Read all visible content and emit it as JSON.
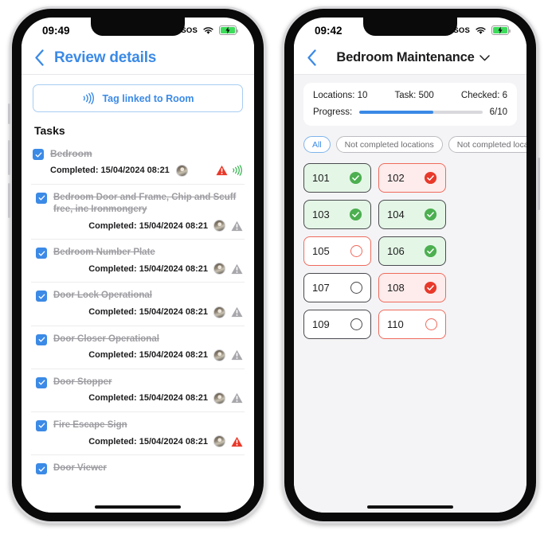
{
  "colors": {
    "accent_blue": "#3b8ae6",
    "green": "#4caf50",
    "green_bg": "#e4f6e6",
    "red": "#e8392a",
    "red_soft": "#ef6a5c",
    "red_bg": "#fdeceb",
    "strike_gray": "#9d9da2"
  },
  "left_phone": {
    "status_bar": {
      "time": "09:49",
      "sos": "SOS",
      "wifi_icon": "wifi-icon",
      "battery_icon": "battery-charging-icon"
    },
    "nav": {
      "back_icon": "chevron-left-icon",
      "title": "Review details"
    },
    "tag_button": {
      "label": "Tag linked to Room",
      "icon": "nfc-wave-icon"
    },
    "section_title": "Tasks",
    "tasks": [
      {
        "label": "Bedroom",
        "checked": true,
        "completed": "Completed: 15/04/2024 08:21",
        "avatar": "user-avatar",
        "warn": "alert-triangle-red-icon",
        "nfc": "nfc-wave-green-icon",
        "top": true
      },
      {
        "label": "Bedroom Door and Frame, Chip and Scuff free, inc Ironmongery",
        "checked": true,
        "completed": "Completed: 15/04/2024 08:21",
        "avatar": "user-avatar",
        "warn": "alert-triangle-gray-icon",
        "top": false
      },
      {
        "label": "Bedroom Number Plate",
        "checked": true,
        "completed": "Completed: 15/04/2024 08:21",
        "avatar": "user-avatar",
        "warn": "alert-triangle-gray-icon",
        "top": false
      },
      {
        "label": "Door Lock Operational",
        "checked": true,
        "completed": "Completed: 15/04/2024 08:21",
        "avatar": "user-avatar",
        "warn": "alert-triangle-gray-icon",
        "top": false
      },
      {
        "label": "Door Closer Operational",
        "checked": true,
        "completed": "Completed: 15/04/2024 08:21",
        "avatar": "user-avatar",
        "warn": "alert-triangle-gray-icon",
        "top": false
      },
      {
        "label": "Door Stopper",
        "checked": true,
        "completed": "Completed: 15/04/2024 08:21",
        "avatar": "user-avatar",
        "warn": "alert-triangle-gray-icon",
        "top": false
      },
      {
        "label": "Fire Escape Sign",
        "checked": true,
        "completed": "Completed: 15/04/2024 08:21",
        "avatar": "user-avatar",
        "warn": "alert-triangle-red-icon",
        "top": false
      },
      {
        "label": "Door Viewer",
        "checked": true,
        "completed": "",
        "avatar": "",
        "warn": "",
        "top": false
      }
    ]
  },
  "right_phone": {
    "status_bar": {
      "time": "09:42",
      "sos": "SOS",
      "wifi_icon": "wifi-icon",
      "battery_icon": "battery-charging-icon"
    },
    "nav": {
      "back_icon": "chevron-left-icon",
      "title": "Bedroom Maintenance",
      "dropdown_icon": "chevron-down-icon"
    },
    "stats": {
      "locations": "Locations: 10",
      "task": "Task: 500",
      "checked": "Checked: 6",
      "progress_label": "Progress:",
      "progress_value": "6/10",
      "progress_percent": 60
    },
    "filters": [
      {
        "label": "All",
        "active": true
      },
      {
        "label": "Not completed locations",
        "active": false
      },
      {
        "label": "Not completed locations",
        "active": false
      }
    ],
    "locations": [
      {
        "number": "101",
        "state": "ok"
      },
      {
        "number": "102",
        "state": "bad"
      },
      {
        "number": "103",
        "state": "ok"
      },
      {
        "number": "104",
        "state": "ok"
      },
      {
        "number": "105",
        "state": "openred"
      },
      {
        "number": "106",
        "state": "ok"
      },
      {
        "number": "107",
        "state": "open"
      },
      {
        "number": "108",
        "state": "bad"
      },
      {
        "number": "109",
        "state": "open"
      },
      {
        "number": "110",
        "state": "openred"
      }
    ]
  }
}
